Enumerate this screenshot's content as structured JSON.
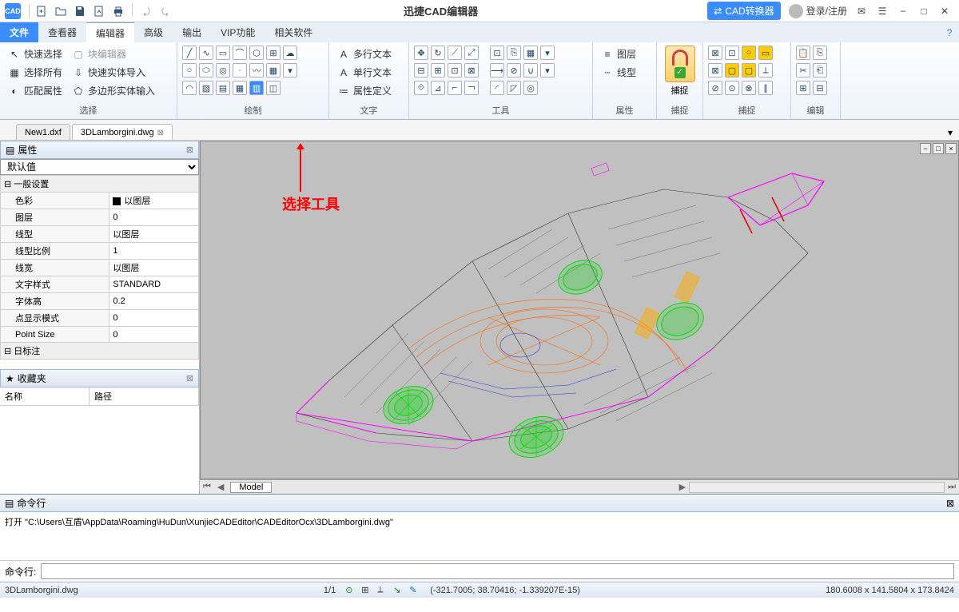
{
  "title": "迅捷CAD编辑器",
  "badge": "CAD转换器",
  "login": "登录/注册",
  "qa_icons": [
    "new",
    "open",
    "save",
    "export",
    "print",
    "undo",
    "redo"
  ],
  "menus": {
    "file": "文件",
    "viewer": "查看器",
    "editor": "编辑器",
    "adv": "高级",
    "output": "输出",
    "vip": "VIP功能",
    "related": "相关软件"
  },
  "ribbon": {
    "select": {
      "label": "选择",
      "quick": "快速选择",
      "block": "块编辑器",
      "all": "选择所有",
      "fast_import": "快速实体导入",
      "match": "匹配属性",
      "poly_input": "多边形实体输入"
    },
    "draw": {
      "label": "绘制"
    },
    "text": {
      "label": "文字",
      "mtext": "多行文本",
      "stext": "单行文本",
      "attdef": "属性定义"
    },
    "tools": {
      "label": "工具"
    },
    "props": {
      "label": "属性",
      "layer": "图层",
      "ltype": "线型"
    },
    "snap": {
      "label": "捕捉",
      "btn": "捕捉"
    },
    "snap2": {
      "label": "捕捉"
    },
    "edit": {
      "label": "编辑"
    }
  },
  "tabs": {
    "t1": "New1.dxf",
    "t2": "3DLamborgini.dwg"
  },
  "panels": {
    "props": {
      "title": "属性",
      "default": "默认值",
      "general": "一般设置",
      "rows": [
        {
          "k": "色彩",
          "v": "以图层",
          "swatch": true
        },
        {
          "k": "图层",
          "v": "0"
        },
        {
          "k": "线型",
          "v": "以图层"
        },
        {
          "k": "线型比例",
          "v": "1"
        },
        {
          "k": "线宽",
          "v": "以图层"
        },
        {
          "k": "文字样式",
          "v": "STANDARD"
        },
        {
          "k": "字体高",
          "v": "0.2"
        },
        {
          "k": "点显示模式",
          "v": "0"
        },
        {
          "k": "Point Size",
          "v": "0"
        }
      ],
      "annot": "日标注"
    },
    "fav": {
      "title": "收藏夹",
      "name": "名称",
      "path": "路径"
    }
  },
  "annotation": "选择工具",
  "model_tab": "Model",
  "cmd": {
    "title": "命令行",
    "log": "打开 \"C:\\Users\\互盾\\AppData\\Roaming\\HuDun\\XunjieCADEditor\\CADEditorOcx\\3DLamborgini.dwg\"",
    "prompt": "命令行:"
  },
  "status": {
    "file": "3DLamborgini.dwg",
    "page": "1/1",
    "coords": "(-321.7005; 38.70416; -1.339207E-15)",
    "dims": "180.6008 x 141.5804 x 173.8424"
  }
}
